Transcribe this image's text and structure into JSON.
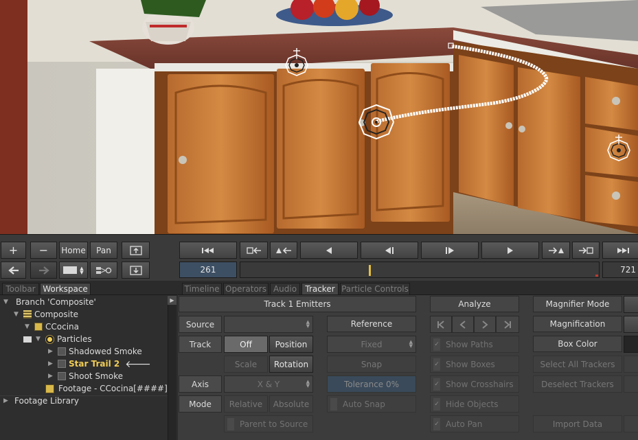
{
  "toolbar": {
    "plus_label": "+",
    "minus_label": "−",
    "home_label": "Home",
    "pan_label": "Pan",
    "start_frame": "261",
    "end_frame": "721",
    "transport_icons": [
      "skip-to-start-icon",
      "set-in-point-icon",
      "key-back-icon",
      "play-reverse-icon",
      "step-back-icon",
      "step-forward-icon",
      "play-forward-icon",
      "key-forward-icon",
      "set-out-point-icon",
      "skip-to-end-icon"
    ],
    "playhead_percent": 36,
    "accent_color": "#e5c03d"
  },
  "tabs": {
    "left": [
      {
        "label": "Toolbar",
        "active": false
      },
      {
        "label": "Workspace",
        "active": true
      }
    ],
    "right": [
      {
        "label": "Timeline",
        "active": false
      },
      {
        "label": "Operators",
        "active": false
      },
      {
        "label": "Audio",
        "active": false
      },
      {
        "label": "Tracker",
        "active": true
      },
      {
        "label": "Particle Controls",
        "active": false
      }
    ]
  },
  "tree": {
    "rows": [
      {
        "label": "Branch 'Composite'",
        "indent": 0,
        "expanded": true
      },
      {
        "label": "Composite",
        "indent": 1,
        "expanded": true
      },
      {
        "label": "CCocina",
        "indent": 2,
        "expanded": true
      },
      {
        "label": "Particles",
        "indent": 3,
        "expanded": true
      },
      {
        "label": "Shadowed Smoke",
        "indent": 4,
        "expanded": false
      },
      {
        "label": "Star Trail 2",
        "indent": 4,
        "expanded": false,
        "selected": true
      },
      {
        "label": "Shoot Smoke",
        "indent": 4,
        "expanded": false
      },
      {
        "label": "Footage - CCocina[####]",
        "indent": 3,
        "expanded": false
      },
      {
        "label": "Footage Library",
        "indent": 0,
        "expanded": false
      }
    ]
  },
  "tracker": {
    "emitters_header": "Track 1 Emitters",
    "source_label": "Source",
    "track_label": "Track",
    "off_label": "Off",
    "position_label": "Position",
    "scale_label": "Scale",
    "rotation_label": "Rotation",
    "axis_label": "Axis",
    "axis_value": "X & Y",
    "mode_label": "Mode",
    "relative_label": "Relative",
    "absolute_label": "Absolute",
    "parent_label": "Parent to Source",
    "reference_header": "Reference",
    "fixed_label": "Fixed",
    "snap_label": "Snap",
    "tolerance_label": "Tolerance 0%",
    "auto_snap_label": "Auto Snap",
    "analyze_header": "Analyze",
    "show_paths": "Show Paths",
    "show_boxes": "Show Boxes",
    "show_crosshairs": "Show Crosshairs",
    "hide_objects": "Hide Objects",
    "auto_pan": "Auto Pan",
    "magnifier_mode": "Magnifier Mode",
    "magnification": "Magnification",
    "box_color": "Box Color",
    "select_all_trackers": "Select All Trackers",
    "deselect_trackers": "Deselect Trackers",
    "import_data": "Import Data"
  }
}
